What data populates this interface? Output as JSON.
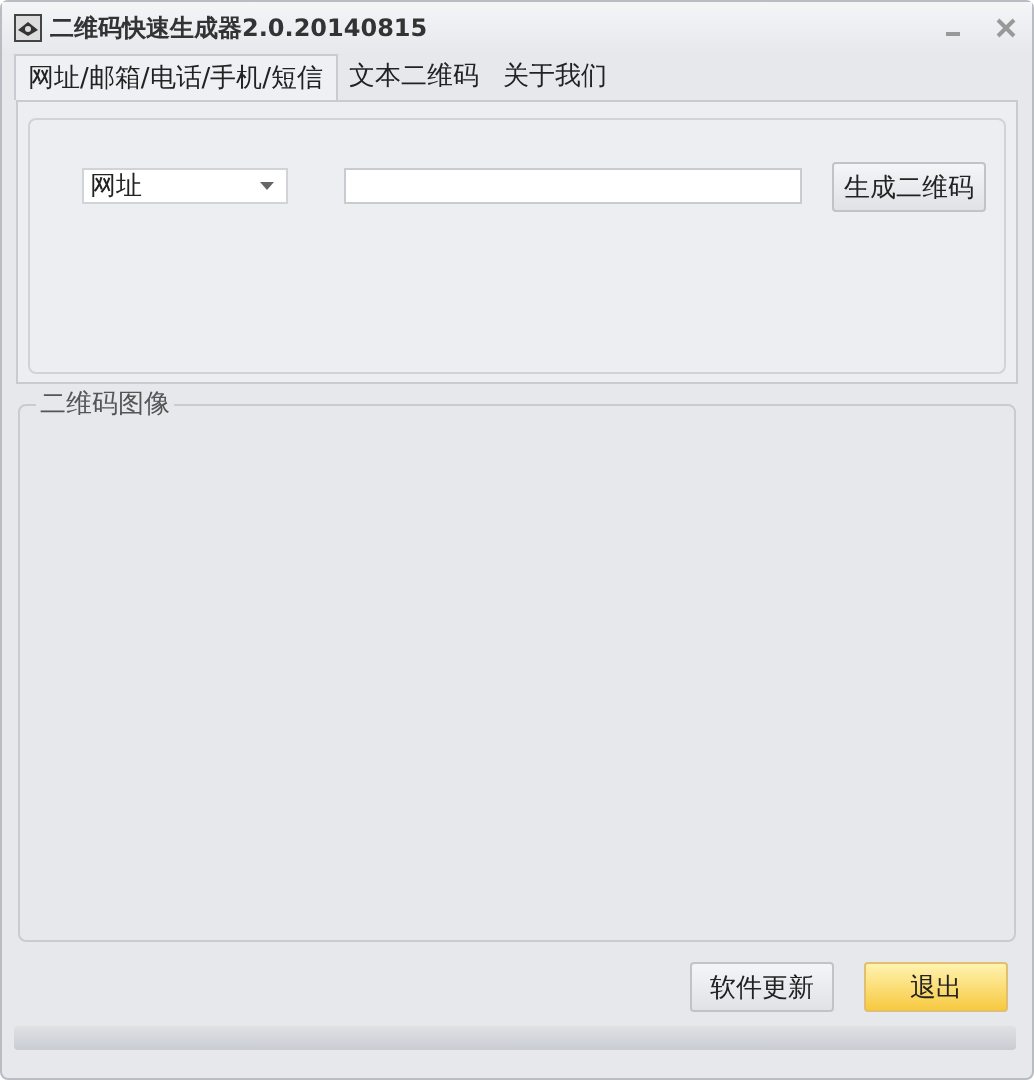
{
  "window": {
    "title": "二维码快速生成器2.0.20140815"
  },
  "tabs": [
    {
      "label": "网址/邮箱/电话/手机/短信",
      "selected": true
    },
    {
      "label": "文本二维码",
      "selected": false
    },
    {
      "label": "关于我们",
      "selected": false
    }
  ],
  "type_dropdown": {
    "value": "网址"
  },
  "generate_button": "生成二维码",
  "image_group": {
    "title": "二维码图像"
  },
  "buttons": [
    {
      "label": "软件更新",
      "kind": "normal"
    },
    {
      "label": "退出",
      "kind": "primary"
    }
  ]
}
